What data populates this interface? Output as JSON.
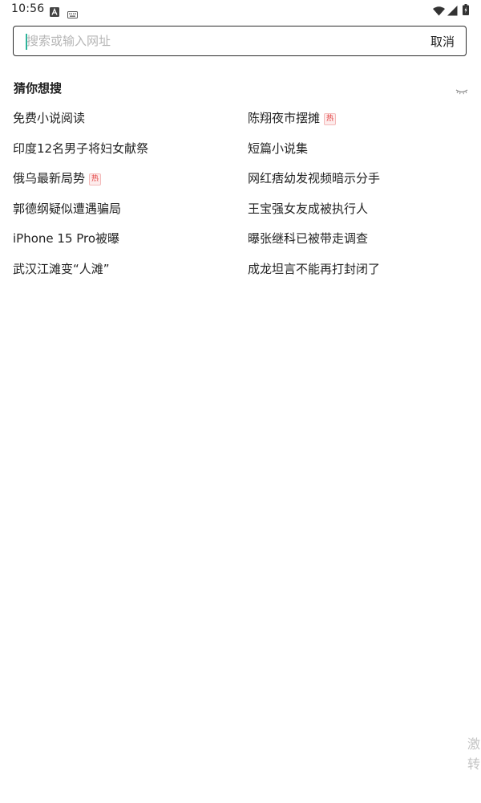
{
  "status_bar": {
    "time": "10:56",
    "icons": [
      "a-notification-icon",
      "keyboard-icon",
      "wifi-icon",
      "signal-icon",
      "battery-icon"
    ]
  },
  "search": {
    "placeholder": "搜索或输入网址",
    "value": "",
    "cancel_label": "取消"
  },
  "suggestions": {
    "title": "猜你想搜",
    "hot_label": "热",
    "left": [
      {
        "text": "免费小说阅读",
        "hot": false
      },
      {
        "text": "印度12名男子将妇女献祭",
        "hot": false
      },
      {
        "text": "俄乌最新局势",
        "hot": true
      },
      {
        "text": "郭德纲疑似遭遇骗局",
        "hot": false
      },
      {
        "text": "iPhone 15 Pro被曝",
        "hot": false
      },
      {
        "text": "武汉江滩变“人滩”",
        "hot": false
      }
    ],
    "right": [
      {
        "text": "陈翔夜市摆摊",
        "hot": true
      },
      {
        "text": "短篇小说集",
        "hot": false
      },
      {
        "text": "网红痞幼发视频暗示分手",
        "hot": false
      },
      {
        "text": "王宝强女友成被执行人",
        "hot": false
      },
      {
        "text": "曝张继科已被带走调查",
        "hot": false
      },
      {
        "text": "成龙坦言不能再打封闭了",
        "hot": false
      }
    ]
  },
  "corner": {
    "line1": "激",
    "line2": "转"
  },
  "colors": {
    "accent_caret": "#2bb39a",
    "hot_badge": "#e23b3b"
  }
}
